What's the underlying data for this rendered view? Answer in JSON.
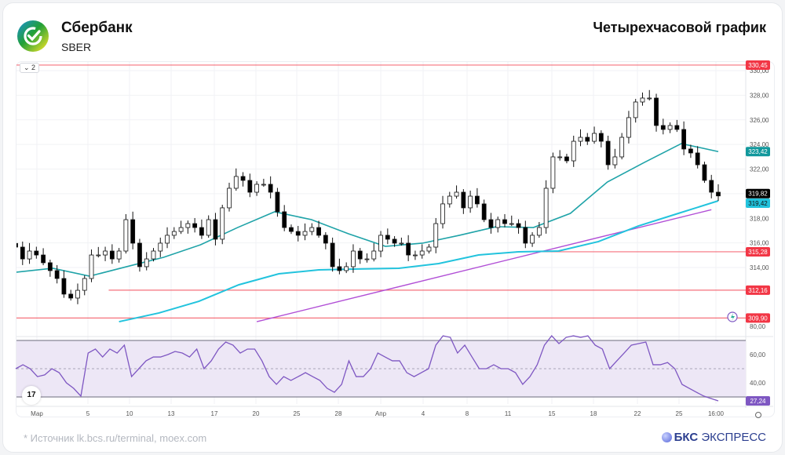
{
  "header": {
    "company": "Сбербанк",
    "ticker": "SBER",
    "chart_title": "Четырехчасовой график",
    "logo_icon": "sber-check-logo"
  },
  "footer": {
    "source": "*  Источник lk.bcs.ru/terminal, moex.com",
    "brand_bold": "БКС",
    "brand_rest": " ЭКСПРЕСС"
  },
  "toolbar": {
    "collapse_label": "⌄ 2",
    "tv_logo": "17"
  },
  "colors": {
    "up": "#ffffff",
    "down": "#000000",
    "ma_fast": "#1fa3a8",
    "ma_slow": "#22c3dd",
    "trend": "#b14fd6",
    "level": "#f23645",
    "rsi": "#7e57c2",
    "rsi_band": "#ede7f6"
  },
  "chart_data": {
    "type": "candlestick",
    "x_ticks": [
      "Мар",
      "5",
      "10",
      "13",
      "17",
      "20",
      "25",
      "28",
      "Апр",
      "4",
      "8",
      "11",
      "15",
      "18",
      "22",
      "25",
      "16:00"
    ],
    "y_ticks": [
      "330,00",
      "328,00",
      "326,00",
      "324,00",
      "322,00",
      "320,00",
      "318,00",
      "316,00",
      "314,00"
    ],
    "ylim": [
      309.4,
      330.8
    ],
    "closes": [
      315.66,
      314.7,
      315.34,
      315.02,
      314.39,
      313.75,
      313.11,
      311.84,
      311.52,
      312.15,
      313.11,
      315.02,
      315.02,
      315.34,
      314.7,
      315.34,
      317.89,
      315.98,
      314.07,
      314.7,
      315.34,
      315.98,
      316.62,
      316.93,
      317.25,
      317.57,
      317.25,
      316.62,
      317.89,
      316.3,
      318.85,
      320.44,
      321.4,
      321.08,
      320.12,
      320.76,
      320.76,
      320.12,
      318.53,
      317.25,
      316.93,
      316.62,
      316.93,
      317.25,
      316.62,
      315.98,
      314.07,
      313.75,
      314.07,
      315.34,
      314.7,
      314.7,
      315.34,
      316.62,
      316.3,
      315.98,
      315.98,
      315.02,
      315.02,
      315.34,
      315.66,
      317.57,
      319.17,
      319.8,
      320.12,
      318.85,
      319.8,
      319.17,
      317.89,
      317.25,
      317.89,
      317.57,
      317.57,
      317.25,
      315.98,
      316.62,
      317.25,
      320.44,
      322.99,
      322.99,
      322.67,
      324.26,
      324.58,
      324.26,
      324.9,
      324.26,
      322.35,
      322.99,
      324.58,
      326.18,
      327.45,
      327.77,
      327.77,
      325.54,
      325.22,
      325.54,
      325.22,
      323.63,
      323.31,
      322.35,
      321.08,
      320.12,
      319.82
    ],
    "ma_fast": {
      "values": [
        313.62,
        313.94,
        313.3,
        314.07,
        314.83,
        315.85,
        317.25,
        318.53,
        317.89,
        316.74,
        315.72,
        315.98,
        316.62,
        317.32,
        317.25,
        318.4,
        320.95,
        322.54,
        324.07,
        323.42
      ],
      "last": "323,42"
    },
    "ma_slow": {
      "start_index": 15,
      "values": [
        309.6,
        310.31,
        311.26,
        312.6,
        313.49,
        313.81,
        313.88,
        313.94,
        314.32,
        315.02,
        315.28,
        315.34,
        316.11,
        317.38,
        318.4,
        319.42
      ],
      "last": "319,42"
    },
    "last_price": "319,82",
    "trendline": [
      [
        35,
        309.6
      ],
      [
        101,
        318.7
      ]
    ],
    "levels": [
      {
        "value": 330.45,
        "label": "330,45",
        "from_index": -2
      },
      {
        "value": 315.28,
        "label": "315,28",
        "from_index": 72.6
      },
      {
        "value": 312.16,
        "label": "312,16",
        "from_index": 13.5
      },
      {
        "value": 309.9,
        "label": "309,90",
        "from_index": -2
      }
    ],
    "rsi": {
      "y_ticks": [
        "80,00",
        "60,00",
        "40,00"
      ],
      "bands": [
        30,
        50,
        70
      ],
      "last": "27,24",
      "values": [
        50,
        52.8,
        50,
        44.4,
        45.6,
        50,
        47.2,
        40,
        36.1,
        30.6,
        61.1,
        63.9,
        58.3,
        63.9,
        61.1,
        66.7,
        44.4,
        50,
        55.6,
        58.3,
        58.3,
        60,
        62.2,
        61.1,
        58.3,
        63.9,
        50,
        55.6,
        63.9,
        68.9,
        66.7,
        61.1,
        63.9,
        63.9,
        55.6,
        44.4,
        38.9,
        44.4,
        41.7,
        44.4,
        47.2,
        44.4,
        41.7,
        36.1,
        33.3,
        38.9,
        55.6,
        44.4,
        44.4,
        50,
        61.1,
        58.3,
        55.6,
        55.6,
        47.2,
        44.4,
        47.2,
        50,
        66.7,
        73.3,
        72.2,
        61.1,
        66.7,
        58.3,
        50,
        50,
        52.8,
        50,
        50,
        47.2,
        38.9,
        44.4,
        52.8,
        66.7,
        73.3,
        67.8,
        72.2,
        73.3,
        72.2,
        73.3,
        66.7,
        63.9,
        50,
        55.6,
        61.1,
        66.7,
        67.8,
        68.9,
        52.8,
        52.8,
        54.4,
        50,
        38.9,
        36.1,
        33.3,
        30.6,
        28.9,
        27.24
      ]
    }
  }
}
